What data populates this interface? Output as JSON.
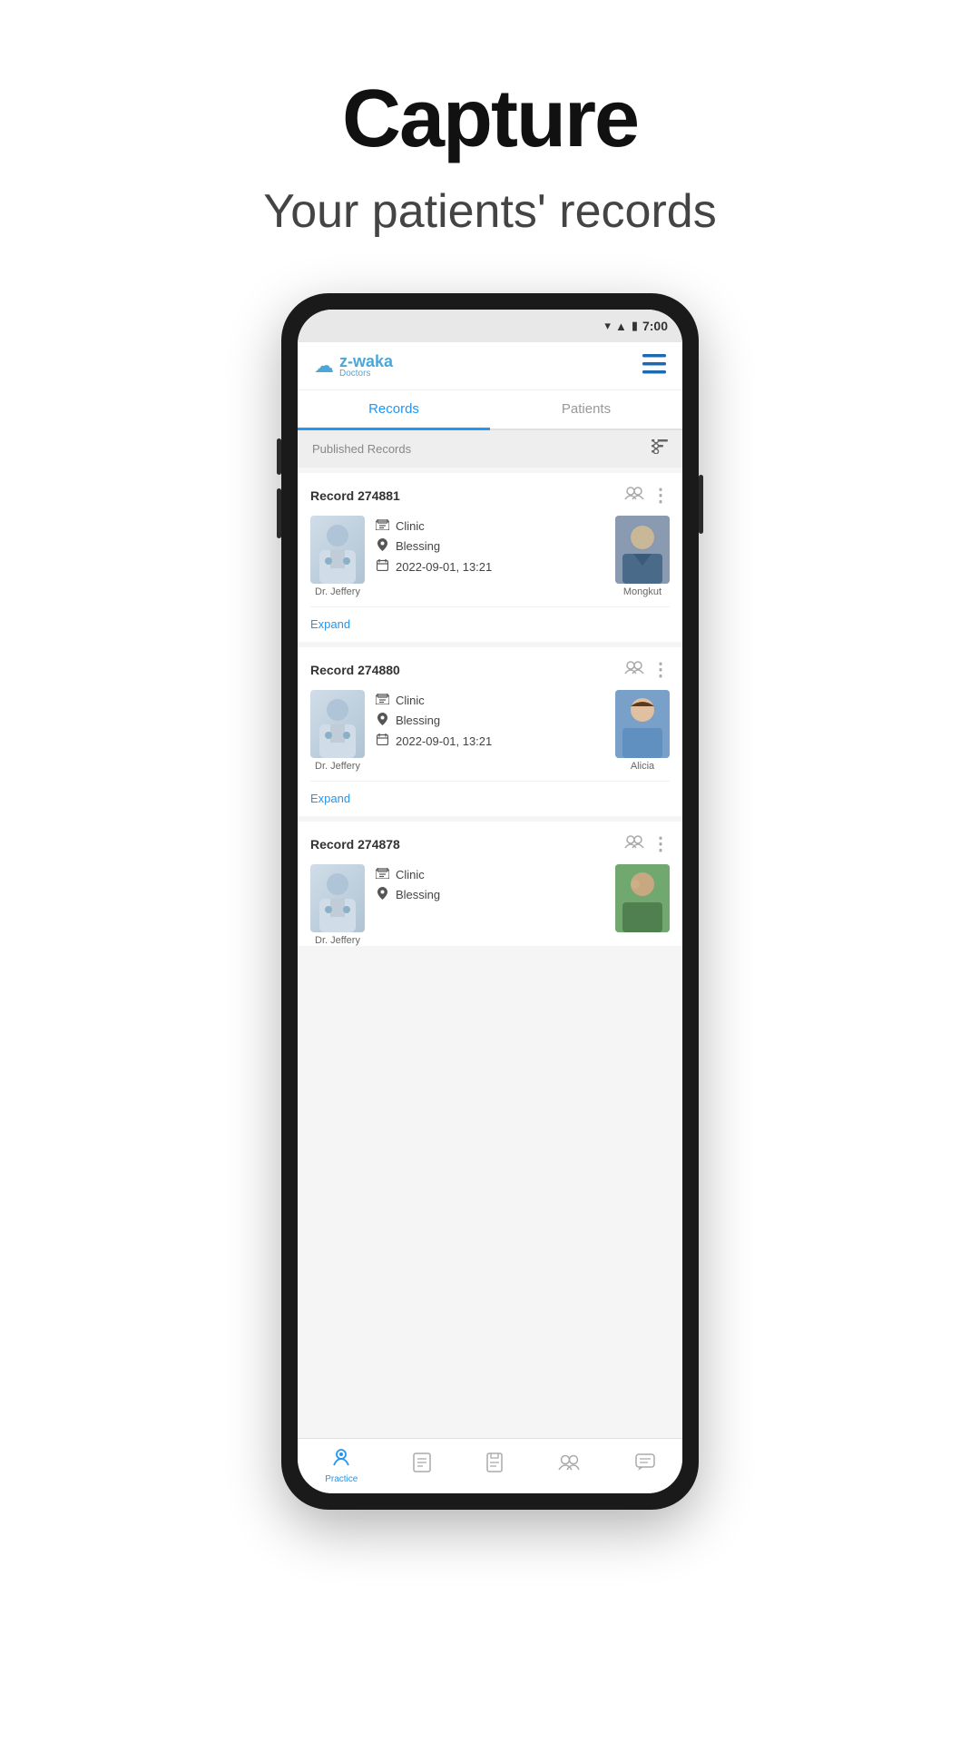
{
  "page": {
    "title": "Capture",
    "subtitle": "Your patients' records"
  },
  "status_bar": {
    "time": "7:00"
  },
  "app": {
    "logo_name": "z-waka",
    "logo_subtitle": "Doctors"
  },
  "tabs": [
    {
      "label": "Records",
      "active": true
    },
    {
      "label": "Patients",
      "active": false
    }
  ],
  "filter": {
    "label": "Published Records"
  },
  "records": [
    {
      "id": "Record 274881",
      "doctor_name": "Dr. Jeffery",
      "type": "Clinic",
      "location": "Blessing",
      "date": "2022-09-01, 13:21",
      "patient_name": "Mongkut"
    },
    {
      "id": "Record 274880",
      "doctor_name": "Dr. Jeffery",
      "type": "Clinic",
      "location": "Blessing",
      "date": "2022-09-01, 13:21",
      "patient_name": "Alicia"
    },
    {
      "id": "Record 274878",
      "doctor_name": "Dr. Jeffery",
      "type": "Clinic",
      "location": "Blessing",
      "date": "",
      "patient_name": ""
    }
  ],
  "expand_label": "Expand",
  "bottom_nav": [
    {
      "label": "Practice",
      "icon": "🏥",
      "active": true
    },
    {
      "label": "",
      "icon": "📋",
      "active": false
    },
    {
      "label": "",
      "icon": "📄",
      "active": false
    },
    {
      "label": "",
      "icon": "👥",
      "active": false
    },
    {
      "label": "",
      "icon": "💬",
      "active": false
    }
  ]
}
